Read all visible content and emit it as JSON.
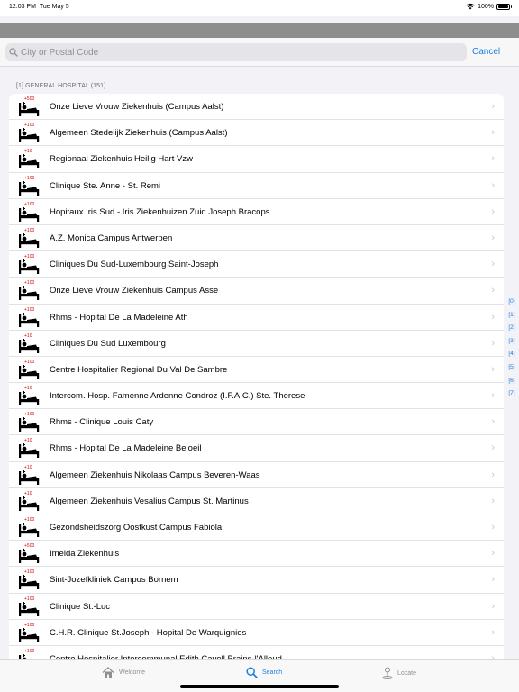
{
  "status_bar": {
    "time": "12:03 PM",
    "date": "Tue May 5",
    "battery": "100%"
  },
  "search": {
    "placeholder": "City or Postal Code",
    "value": "",
    "cancel_label": "Cancel"
  },
  "section_header": "[1] GENERAL HOSPITAL (151)",
  "hospitals": [
    {
      "badge": "+500",
      "name": "Onze Lieve Vrouw Ziekenhuis (Campus Aalst)"
    },
    {
      "badge": "+100",
      "name": "Algemeen Stedelijk Ziekenhuis (Campus Aalst)"
    },
    {
      "badge": "+10",
      "name": "Regionaal Ziekenhuis Heilig Hart Vzw"
    },
    {
      "badge": "+100",
      "name": "Clinique Ste. Anne - St. Remi"
    },
    {
      "badge": "+100",
      "name": "Hopitaux Iris Sud - Iris Ziekenhuizen Zuid Joseph Bracops"
    },
    {
      "badge": "+100",
      "name": "A.Z. Monica Campus Antwerpen"
    },
    {
      "badge": "+100",
      "name": "Cliniques Du Sud-Luxembourg Saint-Joseph"
    },
    {
      "badge": "+100",
      "name": "Onze Lieve Vrouw Ziekenhuis Campus Asse"
    },
    {
      "badge": "+100",
      "name": "Rhms - Hopital De La Madeleine Ath"
    },
    {
      "badge": "+10",
      "name": "Cliniques Du Sud Luxembourg"
    },
    {
      "badge": "+100",
      "name": "Centre Hospitalier Regional Du Val De Sambre"
    },
    {
      "badge": "+10",
      "name": "Intercom. Hosp. Famenne Ardenne Condroz (I.F.A.C.) Ste. Therese"
    },
    {
      "badge": "+100",
      "name": "Rhms - Clinique Louis Caty"
    },
    {
      "badge": "+10",
      "name": "Rhms - Hopital De La Madeleine Beloeil"
    },
    {
      "badge": "+10",
      "name": "Algemeen Ziekenhuis Nikolaas Campus Beveren-Waas"
    },
    {
      "badge": "+10",
      "name": "Algemeen Ziekenhuis Vesalius Campus St. Martinus"
    },
    {
      "badge": "+100",
      "name": "Gezondsheidszorg Oostkust Campus Fabiola"
    },
    {
      "badge": "+500",
      "name": "Imelda Ziekenhuis"
    },
    {
      "badge": "+100",
      "name": "Sint-Jozefkliniek Campus Bornem"
    },
    {
      "badge": "+100",
      "name": "Clinique St.-Luc"
    },
    {
      "badge": "+100",
      "name": "C.H.R. Clinique St.Joseph - Hopital De Warquignies"
    },
    {
      "badge": "+100",
      "name": "Centre Hospitalier Intercommunal Edith Cavell Brains-l'Alleud"
    }
  ],
  "section_index": [
    "[0]",
    "[1]",
    "[2]",
    "[3]",
    "[4]",
    "[5]",
    "[6]",
    "[7]"
  ],
  "tabs": [
    {
      "label": "Welcome",
      "icon": "home-icon",
      "active": false
    },
    {
      "label": "Search",
      "icon": "search-icon",
      "active": true
    },
    {
      "label": "Locate",
      "icon": "locate-pin-icon",
      "active": false
    }
  ],
  "colors": {
    "accent": "#1a7ee0",
    "badge": "#d40000"
  }
}
